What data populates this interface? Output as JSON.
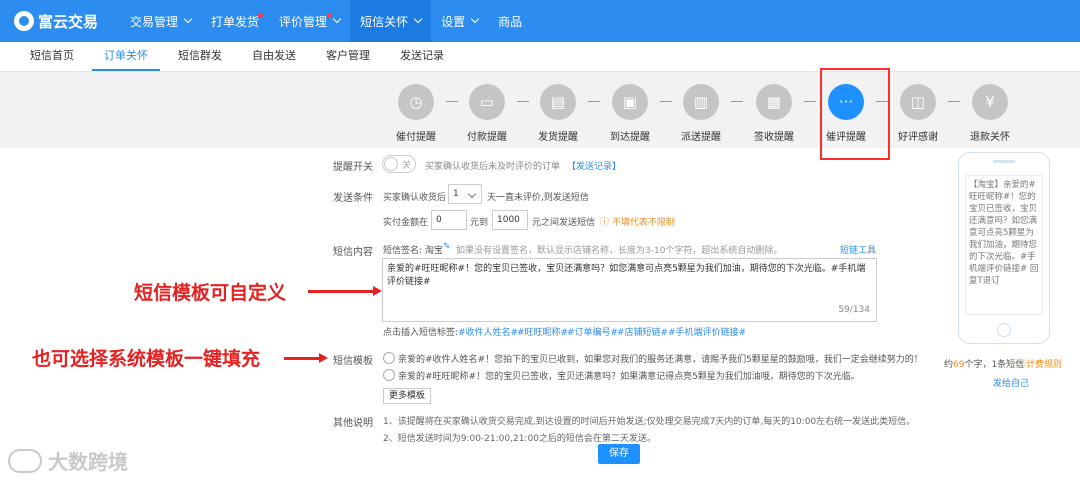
{
  "app": {
    "logo_text": "富云交易"
  },
  "topnav": [
    {
      "label": "交易管理",
      "caret": true,
      "dot": false
    },
    {
      "label": "打单发货",
      "caret": false,
      "dot": true
    },
    {
      "label": "评价管理",
      "caret": true,
      "dot": true
    },
    {
      "label": "短信关怀",
      "caret": true,
      "dot": false,
      "active": true
    },
    {
      "label": "设置",
      "caret": true,
      "dot": false
    },
    {
      "label": "商品",
      "caret": false,
      "dot": false
    }
  ],
  "subnav": [
    {
      "label": "短信首页"
    },
    {
      "label": "订单关怀",
      "active": true
    },
    {
      "label": "短信群发"
    },
    {
      "label": "自由发送"
    },
    {
      "label": "客户管理"
    },
    {
      "label": "发送记录"
    }
  ],
  "steps": [
    {
      "label": "催付提醒",
      "icon": "clock-icon"
    },
    {
      "label": "付款提醒",
      "icon": "wallet-icon"
    },
    {
      "label": "发货提醒",
      "icon": "truck-icon"
    },
    {
      "label": "到达提醒",
      "icon": "box-icon"
    },
    {
      "label": "派送提醒",
      "icon": "delivery-icon"
    },
    {
      "label": "签收提醒",
      "icon": "sign-icon"
    },
    {
      "label": "催评提醒",
      "icon": "chat-icon",
      "active": true
    },
    {
      "label": "好评感谢",
      "icon": "thanks-icon"
    },
    {
      "label": "退款关怀",
      "icon": "refund-icon"
    }
  ],
  "form": {
    "reminder_label": "提醒开关",
    "toggle_text": "关",
    "reminder_desc": "买家确认收货后未及时评价的订单",
    "send_record_link": "【发送记录】",
    "condition_label": "发送条件",
    "condition_prefix": "买家确认收货后",
    "condition_days": "1",
    "condition_suffix": "天一直未评价,则发送短信",
    "amount_prefix": "实付金额在",
    "amount_min": "0",
    "amount_mid": "元到",
    "amount_max": "1000",
    "amount_suffix": "元之间发送短信",
    "amount_note": "不填代表不限制",
    "content_label": "短信内容",
    "signature_label": "短信签名: 淘宝",
    "signature_hint": "如果没有设置签名，默认显示店铺名称，长度为3-10个字符，超出系统自动删除。",
    "sms_tool_link": "短链工具",
    "sms_content": "亲爱的#旺旺昵称#！您的宝贝已签收，宝贝还满意吗？如您满意可点亮5颗星为我们加油，期待您的下次光临。#手机端评价链接#",
    "counter": "59/134",
    "insert_label": "点击插入短信标签:",
    "tags": [
      "#收件人姓名#",
      "#旺旺昵称#",
      "#订单编号#",
      "#店铺短链#",
      "#手机端评价链接#"
    ],
    "template_label": "短信模板",
    "templates": [
      "亲爱的#收件人姓名#！您拍下的宝贝已收到，如果您对我们的服务还满意，请赐予我们5颗星星的鼓励哦，我们一定会继续努力的！",
      "亲爱的#旺旺昵称#！您的宝贝已签收，宝贝还满意吗？如果满意记得点亮5颗星为我们加油哦，期待您的下次光临。"
    ],
    "more_templates": "更多模板",
    "other_label": "其他说明",
    "notes": [
      "1、该提醒将在买家确认收货交易完成,到达设置的时间后开始发送;仅处理交易完成7天内的订单,每天的10:00左右统一发送此类短信。",
      "2、短信发送时间为9:00-21:00,21:00之后的短信会在第二天发送。"
    ],
    "save": "保存"
  },
  "preview": {
    "text": "【淘宝】亲爱的#旺旺昵称#！您的宝贝已签收，宝贝还满意吗？如您满意可点亮5颗星为我们加油，期待您的下次光临。#手机端评价链接# 回复T退订",
    "count_prefix": "约",
    "count_chars": "69",
    "count_mid": "个字，",
    "count_sms": "1条短信",
    "billing_rule": "计费规则",
    "send_self": "发给自己"
  },
  "annotations": {
    "custom": "短信模板可自定义",
    "system": "也可选择系统模板一键填充"
  },
  "watermark": "大数跨境",
  "colors": {
    "primary": "#2d8cf0",
    "active_step": "#1e90ff",
    "highlight": "#ff2d2d",
    "annotation": "#e52222"
  }
}
